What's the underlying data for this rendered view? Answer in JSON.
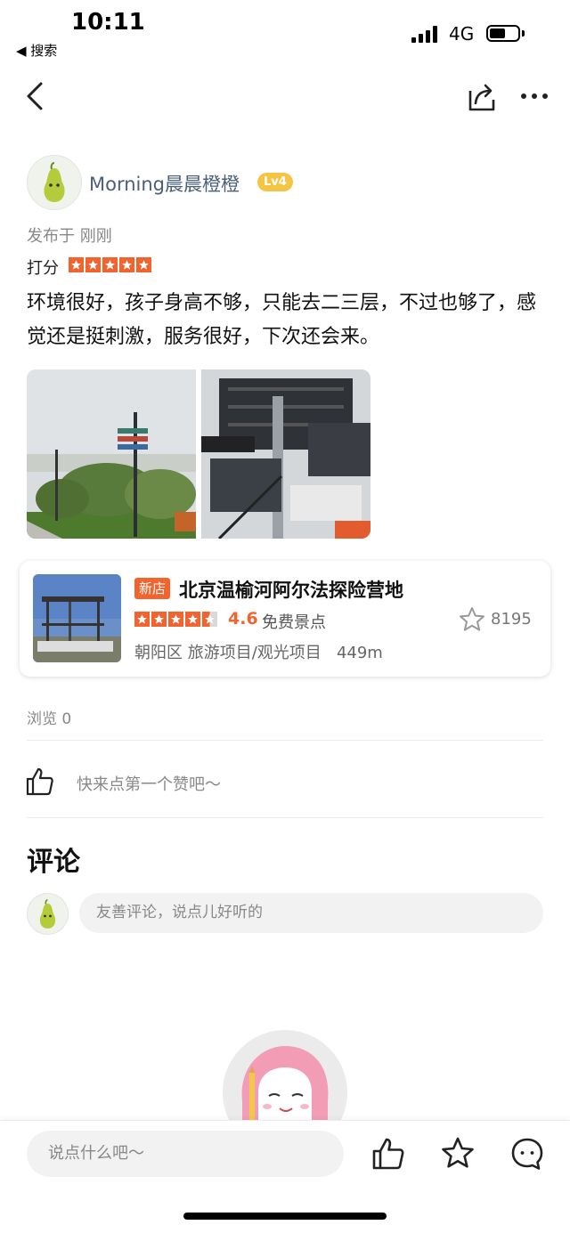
{
  "status_bar": {
    "time": "10:11",
    "back_app": "◀ 搜索",
    "network": "4G",
    "battery_level": 0.55
  },
  "nav": {
    "back_icon": "chevron-left-icon",
    "share_icon": "share-icon",
    "more_icon": "more-icon"
  },
  "author": {
    "name": "Morning晨晨橙橙",
    "level": "Lv4"
  },
  "post": {
    "published": "发布于 刚刚",
    "rating_label": "打分",
    "rating_stars": 5,
    "text": "环境很好，孩子身高不够，只能去二三层，不过也够了，感觉还是挺刺激，服务很好，下次还会来。"
  },
  "poi": {
    "badge": "新店",
    "name": "北京温榆河阿尔法探险营地",
    "stars": 4.5,
    "score": "4.6",
    "price": "免费景点",
    "fav_count": "8195",
    "meta": "朝阳区 旅游项目/观光项目   449m"
  },
  "stats": {
    "views": "浏览 0",
    "like_prompt": "快来点第一个赞吧～"
  },
  "comments": {
    "title": "评论",
    "placeholder": "友善评论，说点儿好听的"
  },
  "bottom_bar": {
    "placeholder": "说点什么吧～"
  },
  "colors": {
    "accent": "#f2632e",
    "level_badge": "#f6c443",
    "author_name": "#4a5f78"
  }
}
